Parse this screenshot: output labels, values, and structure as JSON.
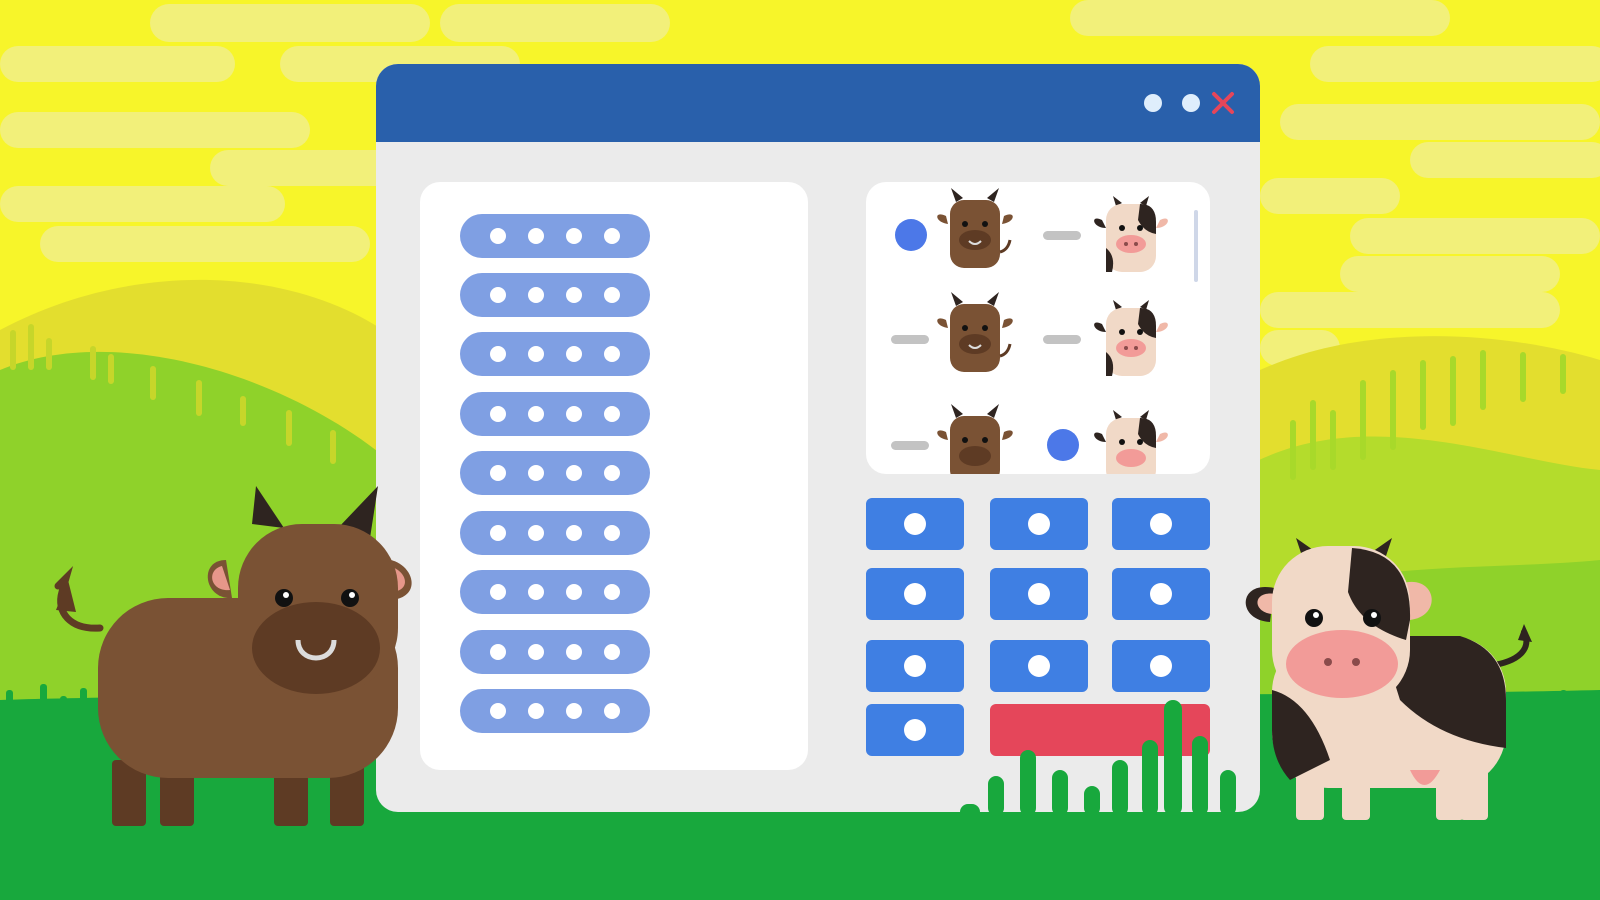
{
  "scene": {
    "sky_color": "#f7f52a",
    "grass_color": "#18a83d",
    "hill_colors": [
      "#e3de2e",
      "#8fd22a",
      "#4fc03a"
    ]
  },
  "window": {
    "titlebar_color": "#2960ab",
    "body_color": "#ebebeb",
    "controls": [
      "minimize-icon",
      "maximize-icon",
      "close-icon"
    ],
    "close_color": "#e5465a"
  },
  "list": {
    "item_count": 9,
    "dots_per_item": 4,
    "item_color": "#7f9fe3"
  },
  "selection_grid": {
    "rows": [
      {
        "bull_choice": "selected",
        "cow_choice": "dash"
      },
      {
        "bull_choice": "dash",
        "cow_choice": "dash"
      },
      {
        "bull_choice": "dash",
        "cow_choice": "selected"
      }
    ],
    "selected_color": "#4c78e8",
    "unselected_color": "#c3c3c3"
  },
  "keypad": {
    "key_count": 10,
    "key_color": "#3f7fe3",
    "action_color": "#e5465a"
  },
  "characters": [
    "bull",
    "cow"
  ]
}
